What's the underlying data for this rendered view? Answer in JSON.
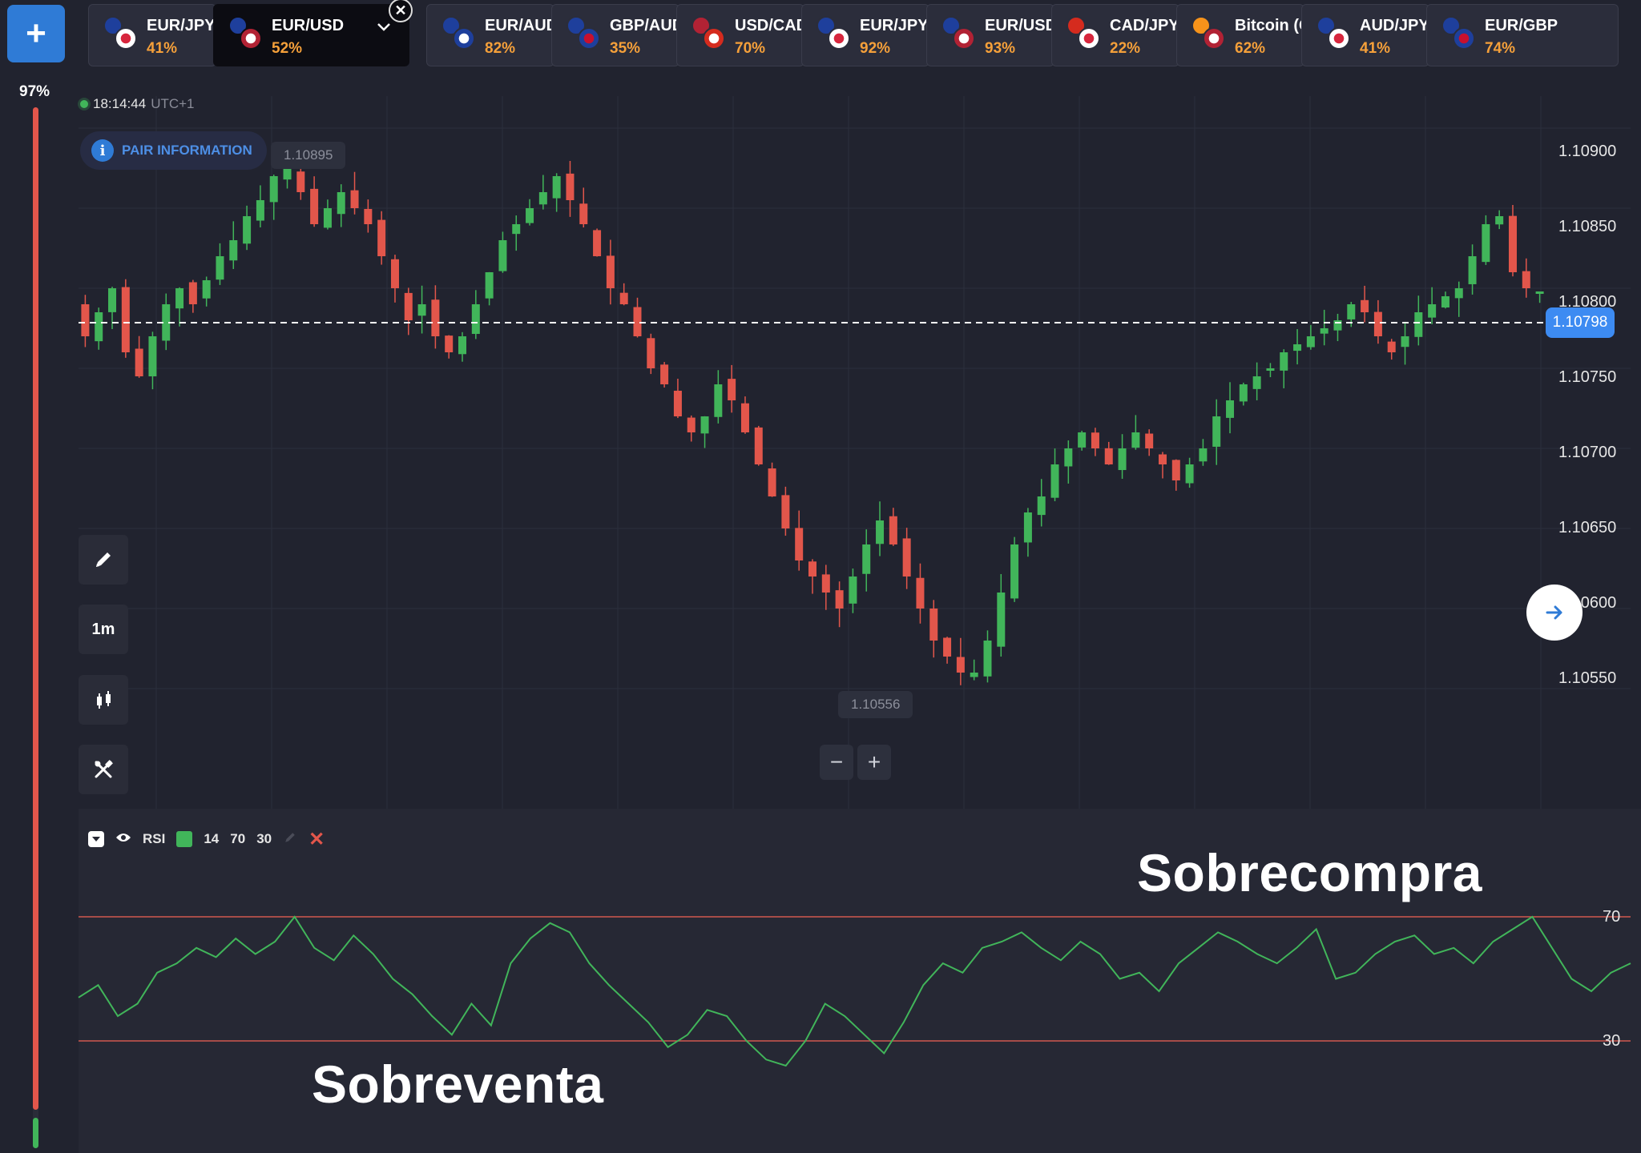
{
  "header": {
    "add_label": "+",
    "tabs": [
      {
        "label": "EUR/JPY",
        "pct": "41%",
        "flag1": "#1e3f9c",
        "flag2": "#ffffff",
        "flag2_dot": "#d7263d"
      },
      {
        "label": "EUR/USD",
        "pct": "52%",
        "flag1": "#1e3f9c",
        "flag2": "#b22234",
        "flag2_dot": "#ffffff",
        "active": true
      },
      {
        "label": "EUR/AUD",
        "pct": "82%",
        "flag1": "#1e3f9c",
        "flag2": "#1e3f9c",
        "flag2_dot": "#ffffff"
      },
      {
        "label": "GBP/AUD",
        "pct": "35%",
        "flag1": "#1e3f9c",
        "flag2": "#1e3f9c",
        "flag2_dot": "#c8102e"
      },
      {
        "label": "USD/CAD",
        "pct": "70%",
        "flag1": "#b22234",
        "flag2": "#d52b1e",
        "flag2_dot": "#ffffff"
      },
      {
        "label": "EUR/JPY",
        "pct": "92%",
        "flag1": "#1e3f9c",
        "flag2": "#ffffff",
        "flag2_dot": "#d7263d"
      },
      {
        "label": "EUR/USD",
        "pct": "93%",
        "flag1": "#1e3f9c",
        "flag2": "#b22234",
        "flag2_dot": "#ffffff"
      },
      {
        "label": "CAD/JPY",
        "pct": "22%",
        "flag1": "#d52b1e",
        "flag2": "#ffffff",
        "flag2_dot": "#d7263d"
      },
      {
        "label": "Bitcoin (OTC)",
        "pct": "62%",
        "flag1": "#f7931a",
        "flag2": "#b22234",
        "flag2_dot": "#ffffff"
      },
      {
        "label": "AUD/JPY",
        "pct": "41%",
        "flag1": "#1e3f9c",
        "flag2": "#ffffff",
        "flag2_dot": "#d7263d"
      },
      {
        "label": "EUR/GBP",
        "pct": "74%",
        "flag1": "#1e3f9c",
        "flag2": "#1e3f9c",
        "flag2_dot": "#c8102e"
      }
    ],
    "close_label": "✕"
  },
  "sidebar": {
    "progress_label": "97%",
    "progress_value": 0.97
  },
  "chart": {
    "clock": "18:14:44",
    "timezone": "UTC+1",
    "pair_info_label": "PAIR INFORMATION",
    "high_tag": "1.10895",
    "low_tag": "1.10556",
    "current_price": "1.10798",
    "price_labels": [
      "1.10900",
      "1.10850",
      "1.10800",
      "1.10750",
      "1.10700",
      "1.10650",
      "1.10600",
      "1.10550"
    ],
    "timeframe": "1m",
    "zoom_out": "−",
    "zoom_in": "+",
    "scroll_icon": "arrow-right-icon"
  },
  "rsi": {
    "name": "RSI",
    "period": "14",
    "upper": "70",
    "lower": "30",
    "level_labels": [
      "70",
      "30"
    ],
    "line_color": "#41b55a",
    "level_color": "#d0584e"
  },
  "annotations": {
    "overbought": "Sobrecompra",
    "oversold": "Sobreventa"
  },
  "colors": {
    "up": "#41b55a",
    "down": "#e2564b",
    "accent": "#2f7bd6",
    "pct": "#f5a03a"
  },
  "chart_data": {
    "type": "candlestick",
    "price_range": [
      1.1053,
      1.1092
    ],
    "closes": [
      1.1077,
      1.10785,
      1.108,
      1.1076,
      1.10745,
      1.1077,
      1.1079,
      1.108,
      1.1079,
      1.10805,
      1.1082,
      1.1083,
      1.10845,
      1.10855,
      1.1087,
      1.10875,
      1.1086,
      1.1084,
      1.1085,
      1.1086,
      1.1085,
      1.1084,
      1.1082,
      1.108,
      1.1078,
      1.1079,
      1.1077,
      1.1076,
      1.1077,
      1.1079,
      1.1081,
      1.1083,
      1.1084,
      1.1085,
      1.1086,
      1.1087,
      1.10855,
      1.1084,
      1.1082,
      1.108,
      1.1079,
      1.1077,
      1.1075,
      1.1074,
      1.1072,
      1.1071,
      1.1072,
      1.1074,
      1.1073,
      1.1071,
      1.1069,
      1.1067,
      1.1065,
      1.1063,
      1.1062,
      1.1061,
      1.106,
      1.1062,
      1.1064,
      1.10655,
      1.1064,
      1.1062,
      1.106,
      1.1058,
      1.1057,
      1.1056,
      1.1056,
      1.1058,
      1.1061,
      1.1064,
      1.1066,
      1.1067,
      1.1069,
      1.107,
      1.1071,
      1.107,
      1.1069,
      1.107,
      1.1071,
      1.107,
      1.1069,
      1.1068,
      1.1069,
      1.107,
      1.1072,
      1.1073,
      1.1074,
      1.10745,
      1.1075,
      1.1076,
      1.10765,
      1.1077,
      1.10775,
      1.1078,
      1.1079,
      1.10785,
      1.1077,
      1.1076,
      1.1077,
      1.10785,
      1.1079,
      1.10795,
      1.108,
      1.1082,
      1.1084,
      1.10845,
      1.1081,
      1.108,
      1.10798
    ],
    "rsi_values": [
      44,
      48,
      38,
      42,
      52,
      55,
      60,
      57,
      63,
      58,
      62,
      70,
      60,
      56,
      64,
      58,
      50,
      45,
      38,
      32,
      42,
      35,
      55,
      63,
      68,
      65,
      55,
      48,
      42,
      36,
      28,
      32,
      40,
      38,
      30,
      24,
      22,
      30,
      42,
      38,
      32,
      26,
      36,
      48,
      55,
      52,
      60,
      62,
      65,
      60,
      56,
      62,
      58,
      50,
      52,
      46,
      55,
      60,
      65,
      62,
      58,
      55,
      60,
      66,
      50,
      52,
      58,
      62,
      64,
      58,
      60,
      55,
      62,
      66,
      70,
      60,
      50,
      46,
      52,
      55
    ],
    "overbought": 70,
    "oversold": 30
  }
}
